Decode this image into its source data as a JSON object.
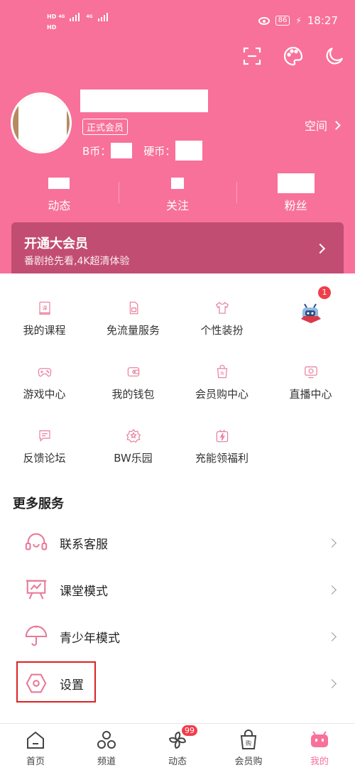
{
  "status_bar": {
    "left_top": "HD",
    "left_bottom": "HD",
    "net1": "4G",
    "net2": "4G",
    "battery": "86",
    "time": "18:27"
  },
  "profile": {
    "member_badge": "正式会员",
    "bcoin_label": "B币：",
    "coin_label": "硬币：",
    "space_label": "空间"
  },
  "stats": [
    {
      "label": "动态"
    },
    {
      "label": "关注"
    },
    {
      "label": "粉丝"
    }
  ],
  "vip": {
    "title": "开通大会员",
    "subtitle": "番剧抢先看,4K超清体验"
  },
  "services": [
    {
      "label": "我的课程",
      "icon": "course-icon"
    },
    {
      "label": "免流量服务",
      "icon": "sim-card-icon"
    },
    {
      "label": "个性装扮",
      "icon": "shirt-icon"
    },
    {
      "label": "",
      "icon": "mascot-icon",
      "badge": "1"
    },
    {
      "label": "游戏中心",
      "icon": "gamepad-icon"
    },
    {
      "label": "我的钱包",
      "icon": "wallet-icon"
    },
    {
      "label": "会员购中心",
      "icon": "shopping-bag-icon"
    },
    {
      "label": "直播中心",
      "icon": "tv-icon"
    },
    {
      "label": "反馈论坛",
      "icon": "chat-icon"
    },
    {
      "label": "BW乐园",
      "icon": "star-badge-icon"
    },
    {
      "label": "充能领福利",
      "icon": "gift-bolt-icon"
    }
  ],
  "more": {
    "title": "更多服务",
    "items": [
      {
        "label": "联系客服",
        "icon": "headset-icon"
      },
      {
        "label": "课堂模式",
        "icon": "classroom-icon"
      },
      {
        "label": "青少年模式",
        "icon": "umbrella-icon"
      },
      {
        "label": "设置",
        "icon": "settings-icon"
      }
    ]
  },
  "tabbar": [
    {
      "label": "首页",
      "icon": "home-icon"
    },
    {
      "label": "频道",
      "icon": "channels-icon"
    },
    {
      "label": "动态",
      "icon": "pinwheel-icon",
      "badge": "99"
    },
    {
      "label": "会员购",
      "icon": "shopping-bag-icon"
    },
    {
      "label": "我的",
      "icon": "tv-mascot-icon"
    }
  ],
  "colors": {
    "accent": "#f8719a",
    "vip_bg": "#c24d72",
    "badge_red": "#ef3e4a",
    "highlight": "#dd2222"
  }
}
